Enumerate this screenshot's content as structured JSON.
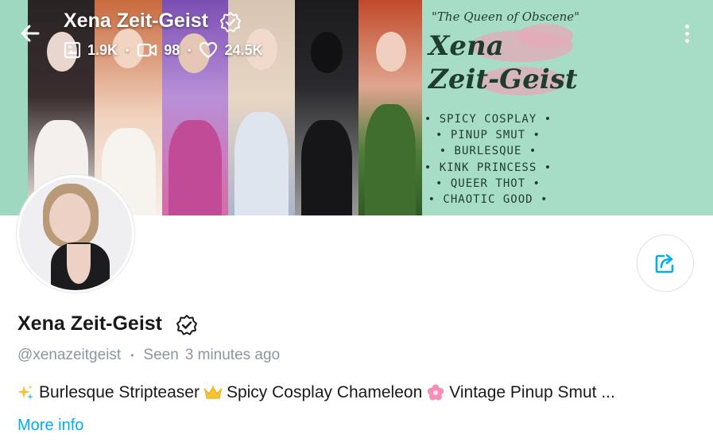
{
  "header": {
    "name": "Xena Zeit-Geist",
    "stats": [
      {
        "icon": "image-icon",
        "value": "1.9K"
      },
      {
        "icon": "video-icon",
        "value": "98"
      },
      {
        "icon": "heart-icon",
        "value": "24.5K"
      }
    ]
  },
  "banner": {
    "subtitle": "\"The Queen of Obscene\"",
    "name_line1": "Xena",
    "name_line2": "Zeit-Geist",
    "taglines": [
      "• SPICY COSPLAY •",
      "• PINUP SMUT •",
      "• BURLESQUE •",
      "• KINK PRINCESS •",
      "• QUEER THOT •",
      "• CHAOTIC GOOD •"
    ]
  },
  "profile": {
    "name": "Xena Zeit-Geist",
    "handle": "@xenazeitgeist",
    "seen_label": "Seen",
    "seen_time": "3 minutes ago"
  },
  "bio": {
    "part1": "Burlesque Stripteaser",
    "part2": "Spicy Cosplay Chameleon",
    "part3": "Vintage Pinup Smut ...",
    "emojis": [
      "sparkles-icon",
      "crown-icon",
      "flower-icon"
    ]
  },
  "more_info": "More info",
  "colors": {
    "accent": "#00aff0",
    "muted": "#8a96a3",
    "banner_bg": "#a7dcc6",
    "banner_text": "#1f3d2e"
  }
}
